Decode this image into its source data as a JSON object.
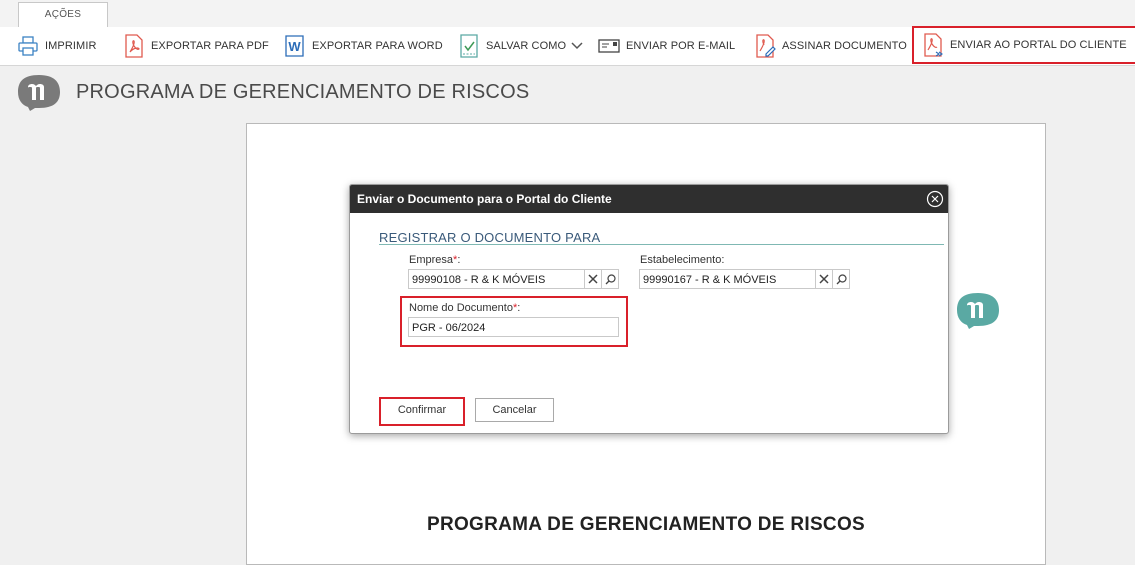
{
  "tabs": {
    "acoes": "AÇÕES"
  },
  "toolbar": {
    "imprimir": "IMPRIMIR",
    "exportar_pdf": "EXPORTAR PARA PDF",
    "exportar_word": "EXPORTAR PARA WORD",
    "salvar_como": "SALVAR COMO",
    "enviar_email": "ENVIAR POR E-MAIL",
    "assinar": "ASSINAR DOCUMENTO",
    "enviar_portal": "ENVIAR AO PORTAL DO CLIENTE"
  },
  "page": {
    "title": "PROGRAMA DE GERENCIAMENTO DE RISCOS"
  },
  "document": {
    "heading": "PROGRAMA DE GERENCIAMENTO DE RISCOS"
  },
  "modal": {
    "title": "Enviar o Documento para o Portal do Cliente",
    "section_title": "REGISTRAR O DOCUMENTO PARA",
    "empresa_label": "Empresa",
    "empresa_value": "99990108 - R & K MÓVEIS",
    "estabelecimento_label": "Estabelecimento:",
    "estabelecimento_value": "99990167 - R & K MÓVEIS",
    "nome_label": "Nome do Documento",
    "nome_value": "PGR - 06/2024",
    "required_mark": "*",
    "colon": ":",
    "confirm": "Confirmar",
    "cancel": "Cancelar"
  },
  "colors": {
    "highlight": "#d9202a",
    "modal_header": "#2f2f2f",
    "accent_teal": "#5aa9a3"
  }
}
